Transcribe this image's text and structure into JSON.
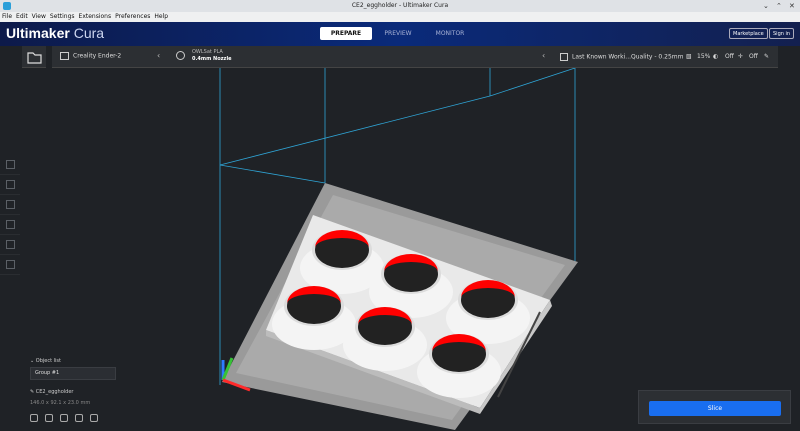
{
  "window": {
    "title": "CE2_eggholder - Ultimaker Cura",
    "controls": [
      "⌄",
      "⌃",
      "✕"
    ]
  },
  "menu": [
    "File",
    "Edit",
    "View",
    "Settings",
    "Extensions",
    "Preferences",
    "Help"
  ],
  "header": {
    "brand_bold": "Ultimaker",
    "brand_light": " Cura",
    "tabs": [
      "PREPARE",
      "PREVIEW",
      "MONITOR"
    ],
    "active_tab": "PREPARE",
    "marketplace": "Marketplace",
    "signin": "Sign in"
  },
  "toolbar": {
    "printer": "Creality Ender-2",
    "material_name": "OWLSat PLA",
    "nozzle": "0.4mm Nozzle",
    "quality": "Last Known Worki...Quality - 0.25mm",
    "infill": "15%",
    "support": "Off",
    "adhesion": "Off"
  },
  "tools": [
    "move-tool",
    "scale-tool",
    "rotate-tool",
    "mirror-tool",
    "per-model-settings-tool",
    "support-blocker-tool"
  ],
  "objects": {
    "header": "Object list",
    "group": "Group #1",
    "name": "CE2_eggholder",
    "dims": "146.0 x 92.1 x 23.0 mm"
  },
  "slice": {
    "label": "Slice"
  },
  "colors": {
    "accent": "#196ef0",
    "overhang": "#ff0000"
  }
}
